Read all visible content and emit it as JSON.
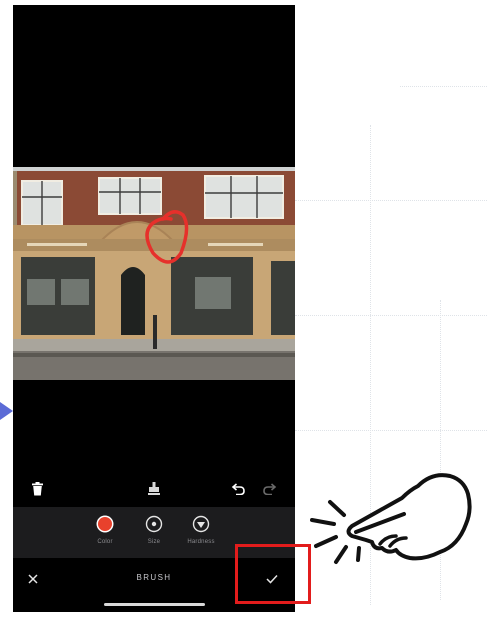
{
  "screen": {
    "title": "BRUSH"
  },
  "toolbar": {
    "delete_icon": "trash-icon",
    "stamp_icon": "stamp-icon",
    "undo_icon": "undo-icon",
    "redo_icon": "redo-icon"
  },
  "brush_options": [
    {
      "label": "Color",
      "icon": "color-swatch-icon",
      "color": "#e8412c"
    },
    {
      "label": "Size",
      "icon": "size-icon"
    },
    {
      "label": "Hardness",
      "icon": "hardness-icon"
    }
  ],
  "bottom_bar": {
    "close_icon": "close-icon",
    "confirm_icon": "checkmark-icon"
  },
  "annotations": {
    "highlight_color": "#e21c1c",
    "pointer": "pointing-hand-icon",
    "arrow_color": "#5b6bd6"
  }
}
